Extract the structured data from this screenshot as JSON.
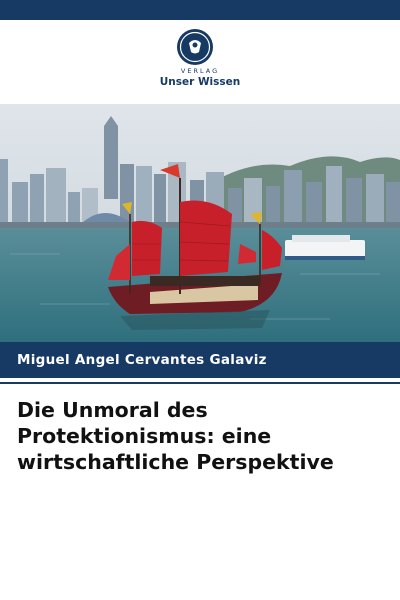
{
  "publisher": {
    "small_label": "VERLAG",
    "name": "Unser Wissen"
  },
  "book": {
    "author": "Miguel Angel Cervantes Galaviz",
    "title": "Die Unmoral des Protektionismus: eine wirtschaftliche Perspektive"
  },
  "colors": {
    "band": "#163a63",
    "sail": "#c8202a",
    "water": "#3f8190",
    "sky": "#d6dee4"
  },
  "cover_image": {
    "icon": "junk-boat-harbor-image"
  }
}
